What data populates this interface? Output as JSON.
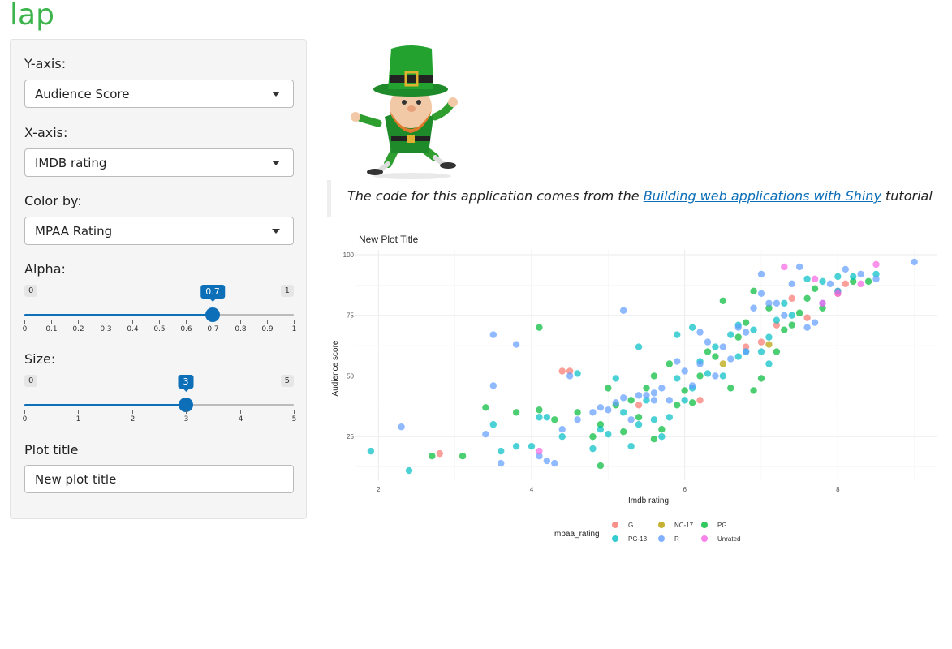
{
  "app": {
    "title": "lap"
  },
  "sidebar": {
    "y_axis": {
      "label": "Y-axis:",
      "value": "Audience Score"
    },
    "x_axis": {
      "label": "X-axis:",
      "value": "IMDB rating"
    },
    "color_by": {
      "label": "Color by:",
      "value": "MPAA Rating"
    },
    "alpha": {
      "label": "Alpha:",
      "min_label": "0",
      "max_label": "1",
      "value_label": "0.7",
      "value": 0.7,
      "min": 0,
      "max": 1,
      "ticks": [
        "0",
        "0.1",
        "0.2",
        "0.3",
        "0.4",
        "0.5",
        "0.6",
        "0.7",
        "0.8",
        "0.9",
        "1"
      ]
    },
    "size": {
      "label": "Size:",
      "min_label": "0",
      "max_label": "5",
      "value_label": "3",
      "value": 3,
      "min": 0,
      "max": 5,
      "ticks": [
        "0",
        "1",
        "2",
        "3",
        "4",
        "5"
      ]
    },
    "plot_title": {
      "label": "Plot title",
      "value": "New plot title"
    }
  },
  "main": {
    "mascot_name": "leprechaun-image",
    "caption": {
      "before": "The code for this application comes from the ",
      "link": "Building web applications with Shiny",
      "after": " tutorial"
    }
  },
  "chart_data": {
    "type": "scatter",
    "title": "New Plot Title",
    "xlabel": "Imdb rating",
    "ylabel": "Audience score",
    "xlim": [
      1.7,
      9.3
    ],
    "ylim": [
      7,
      102
    ],
    "xticks": [
      "2",
      "4",
      "6",
      "8"
    ],
    "yticks": [
      "25",
      "50",
      "75",
      "100"
    ],
    "legend_title": "mpaa_rating",
    "legend_position": "bottom",
    "grid": true,
    "colors": {
      "G": "#F8766D",
      "NC-17": "#B79F00",
      "PG": "#00BA38",
      "PG-13": "#00BFC4",
      "R": "#619CFF",
      "Unrated": "#F564E3"
    },
    "series": [
      {
        "name": "G",
        "points": [
          [
            2.8,
            18
          ],
          [
            4.4,
            52
          ],
          [
            4.5,
            52
          ],
          [
            6.2,
            40
          ],
          [
            6.8,
            62
          ],
          [
            7.2,
            71
          ],
          [
            7.6,
            74
          ],
          [
            7.4,
            82
          ],
          [
            8.0,
            84
          ],
          [
            8.1,
            88
          ],
          [
            5.4,
            38
          ],
          [
            7.0,
            64
          ]
        ]
      },
      {
        "name": "NC-17",
        "points": [
          [
            6.5,
            55
          ],
          [
            7.1,
            63
          ]
        ]
      },
      {
        "name": "PG",
        "points": [
          [
            2.7,
            17
          ],
          [
            3.1,
            17
          ],
          [
            3.4,
            37
          ],
          [
            3.8,
            35
          ],
          [
            4.1,
            36
          ],
          [
            4.3,
            32
          ],
          [
            4.6,
            35
          ],
          [
            4.8,
            25
          ],
          [
            4.9,
            13
          ],
          [
            4.9,
            30
          ],
          [
            5.0,
            45
          ],
          [
            5.1,
            38
          ],
          [
            5.3,
            40
          ],
          [
            5.4,
            33
          ],
          [
            5.6,
            50
          ],
          [
            5.6,
            24
          ],
          [
            5.7,
            28
          ],
          [
            5.8,
            55
          ],
          [
            5.9,
            38
          ],
          [
            6.0,
            44
          ],
          [
            6.1,
            39
          ],
          [
            6.2,
            50
          ],
          [
            6.4,
            58
          ],
          [
            6.5,
            81
          ],
          [
            6.6,
            45
          ],
          [
            6.7,
            66
          ],
          [
            6.8,
            72
          ],
          [
            6.9,
            44
          ],
          [
            7.0,
            49
          ],
          [
            7.2,
            60
          ],
          [
            7.3,
            69
          ],
          [
            7.4,
            71
          ],
          [
            7.5,
            76
          ],
          [
            7.6,
            82
          ],
          [
            7.8,
            78
          ],
          [
            8.0,
            85
          ],
          [
            8.2,
            89
          ],
          [
            8.4,
            89
          ],
          [
            6.3,
            60
          ],
          [
            6.9,
            85
          ],
          [
            7.1,
            78
          ],
          [
            7.7,
            86
          ],
          [
            5.2,
            27
          ],
          [
            5.5,
            45
          ],
          [
            4.1,
            70
          ]
        ]
      },
      {
        "name": "PG-13",
        "points": [
          [
            1.9,
            19
          ],
          [
            2.4,
            11
          ],
          [
            3.5,
            30
          ],
          [
            3.6,
            19
          ],
          [
            3.8,
            21
          ],
          [
            4.0,
            21
          ],
          [
            4.1,
            33
          ],
          [
            4.2,
            33
          ],
          [
            4.4,
            25
          ],
          [
            4.6,
            51
          ],
          [
            4.8,
            20
          ],
          [
            4.9,
            28
          ],
          [
            5.0,
            26
          ],
          [
            5.1,
            49
          ],
          [
            5.2,
            35
          ],
          [
            5.3,
            21
          ],
          [
            5.4,
            30
          ],
          [
            5.5,
            40
          ],
          [
            5.6,
            32
          ],
          [
            5.7,
            25
          ],
          [
            5.8,
            33
          ],
          [
            5.9,
            49
          ],
          [
            6.0,
            40
          ],
          [
            6.1,
            45
          ],
          [
            6.2,
            56
          ],
          [
            6.3,
            51
          ],
          [
            6.4,
            62
          ],
          [
            6.5,
            50
          ],
          [
            6.6,
            67
          ],
          [
            6.7,
            58
          ],
          [
            6.8,
            60
          ],
          [
            6.9,
            69
          ],
          [
            7.0,
            60
          ],
          [
            7.1,
            66
          ],
          [
            7.2,
            73
          ],
          [
            7.3,
            80
          ],
          [
            7.4,
            75
          ],
          [
            7.6,
            90
          ],
          [
            7.8,
            89
          ],
          [
            8.0,
            91
          ],
          [
            8.2,
            91
          ],
          [
            8.5,
            92
          ],
          [
            5.4,
            62
          ],
          [
            5.9,
            67
          ],
          [
            6.7,
            71
          ],
          [
            7.1,
            55
          ],
          [
            6.1,
            70
          ]
        ]
      },
      {
        "name": "R",
        "points": [
          [
            2.3,
            29
          ],
          [
            3.4,
            26
          ],
          [
            3.5,
            67
          ],
          [
            3.5,
            46
          ],
          [
            3.6,
            14
          ],
          [
            3.8,
            63
          ],
          [
            4.1,
            17
          ],
          [
            4.2,
            15
          ],
          [
            4.3,
            14
          ],
          [
            4.4,
            28
          ],
          [
            4.5,
            50
          ],
          [
            4.6,
            32
          ],
          [
            4.8,
            35
          ],
          [
            5.0,
            36
          ],
          [
            5.2,
            41
          ],
          [
            5.3,
            32
          ],
          [
            5.4,
            42
          ],
          [
            5.5,
            42
          ],
          [
            5.6,
            40
          ],
          [
            5.7,
            45
          ],
          [
            5.8,
            40
          ],
          [
            5.9,
            56
          ],
          [
            6.0,
            52
          ],
          [
            6.1,
            46
          ],
          [
            6.2,
            55
          ],
          [
            6.3,
            64
          ],
          [
            6.4,
            50
          ],
          [
            6.5,
            62
          ],
          [
            6.6,
            57
          ],
          [
            6.7,
            70
          ],
          [
            6.8,
            68
          ],
          [
            6.9,
            78
          ],
          [
            7.0,
            84
          ],
          [
            7.1,
            80
          ],
          [
            7.2,
            80
          ],
          [
            7.3,
            75
          ],
          [
            7.4,
            88
          ],
          [
            7.5,
            95
          ],
          [
            7.6,
            70
          ],
          [
            7.7,
            72
          ],
          [
            7.8,
            80
          ],
          [
            7.9,
            88
          ],
          [
            8.0,
            85
          ],
          [
            8.1,
            94
          ],
          [
            8.3,
            92
          ],
          [
            8.5,
            90
          ],
          [
            9.0,
            97
          ],
          [
            7.0,
            92
          ],
          [
            5.2,
            77
          ],
          [
            6.2,
            68
          ],
          [
            5.6,
            43
          ],
          [
            6.8,
            60
          ],
          [
            5.1,
            39
          ],
          [
            4.9,
            37
          ]
        ]
      },
      {
        "name": "Unrated",
        "points": [
          [
            4.1,
            19
          ],
          [
            7.3,
            95
          ],
          [
            7.7,
            90
          ],
          [
            8.0,
            84
          ],
          [
            8.3,
            88
          ],
          [
            8.5,
            96
          ],
          [
            7.8,
            80
          ]
        ]
      }
    ]
  }
}
